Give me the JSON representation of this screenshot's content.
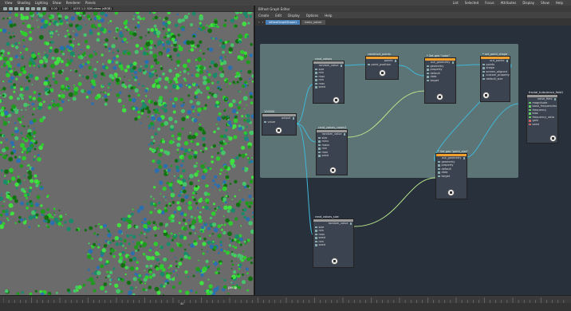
{
  "top_menu": {
    "left_items": [
      "View",
      "Shading",
      "Lighting",
      "Show",
      "Renderer",
      "Panels"
    ],
    "right_items": [
      "List",
      "Selected",
      "Focus",
      "Attributes",
      "Display",
      "Show",
      "Help"
    ]
  },
  "viewport": {
    "toolbar_values": [
      "0.00",
      "1.00"
    ],
    "toolbar_label": "ACES 1.0 SDR-video (sRGB)",
    "camera_label": "persp"
  },
  "timeline": {
    "current_frame": "40"
  },
  "graph_editor": {
    "title": "Bifrost Graph Editor",
    "menu": [
      "Create",
      "Edit",
      "Display",
      "Options",
      "Help"
    ],
    "tabs": [
      "bifrostGraphShape1",
      "basic_solver"
    ],
    "nodes": {
      "rand_values": {
        "title": "rand_values",
        "ports": [
          "size",
          "min",
          "max",
          "min",
          "max",
          "seed"
        ],
        "output": "random_value"
      },
      "construct_points": {
        "title": "construct_points",
        "ports": [
          "point_position"
        ],
        "output": "points"
      },
      "set_geo_color": {
        "title": "* Set geo \"color\"",
        "ports": [
          "geometry",
          "property",
          "default",
          "data",
          "target"
        ],
        "output": "out_geometry"
      },
      "set_point_shape": {
        "title": "* set_point_shape",
        "ports": [
          "points",
          "shape",
          "screen_aligned",
          "custom_property",
          "default_size"
        ],
        "output": "out_points"
      },
      "value_node": {
        "title": "100000",
        "ports": [
          "value"
        ],
        "output": "output"
      },
      "rand_values_colors": {
        "title": "rand_values_colors1",
        "ports": [
          "size",
          "minx",
          "maxx",
          "min",
          "max",
          "seed"
        ],
        "output": "random_value"
      },
      "set_geo_point_size": {
        "title": "* Set geo \"point_size\"",
        "ports": [
          "geometry",
          "property",
          "default",
          "data",
          "target"
        ],
        "output": "out_geometry"
      },
      "fractal_turbulence": {
        "title": "fractal_turbulence_field1",
        "ports": [
          "magnitude",
          "base_frequencies",
          "frequency",
          "bias",
          "frequency_ratio",
          "gain",
          "seed"
        ],
        "output": "noise_field"
      },
      "rand_values_size": {
        "title": "rand_values_size",
        "ports": [
          "size",
          "min",
          "max",
          "seed",
          "min",
          "seed"
        ],
        "output": "random_value"
      }
    }
  },
  "colors": {
    "node_header_orange": "#f0a030",
    "wire_cyan": "#3fb8d8",
    "wire_green": "#b7e28a",
    "compound_bg": "#5f7878",
    "canvas_bg": "#28303c"
  }
}
